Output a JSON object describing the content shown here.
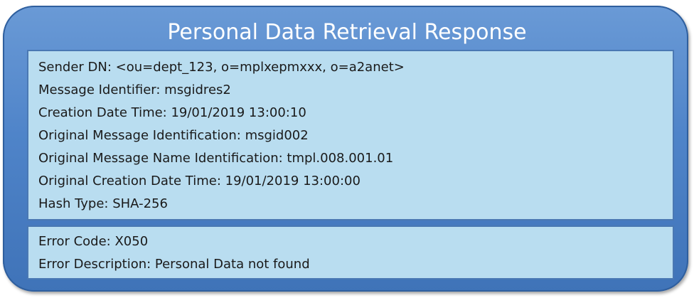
{
  "title": "Personal Data Retrieval Response",
  "info_lines": [
    "Sender DN: <ou=dept_123, o=mplxepmxxx, o=a2anet>",
    "Message Identifier: msgidres2",
    "Creation Date Time: 19/01/2019 13:00:10",
    "Original Message Identification: msgid002",
    "Original Message Name Identification: tmpl.008.001.01",
    "Original Creation Date Time: 19/01/2019 13:00:00",
    "Hash Type: SHA-256"
  ],
  "error_lines": [
    "Error Code: X050",
    "Error Description: Personal Data not found"
  ],
  "colors": {
    "outer_fill": "#4f84c9",
    "panel_fill": "#b9ddf0",
    "panel_border": "#4a78b3",
    "title_text": "#ffffff"
  }
}
